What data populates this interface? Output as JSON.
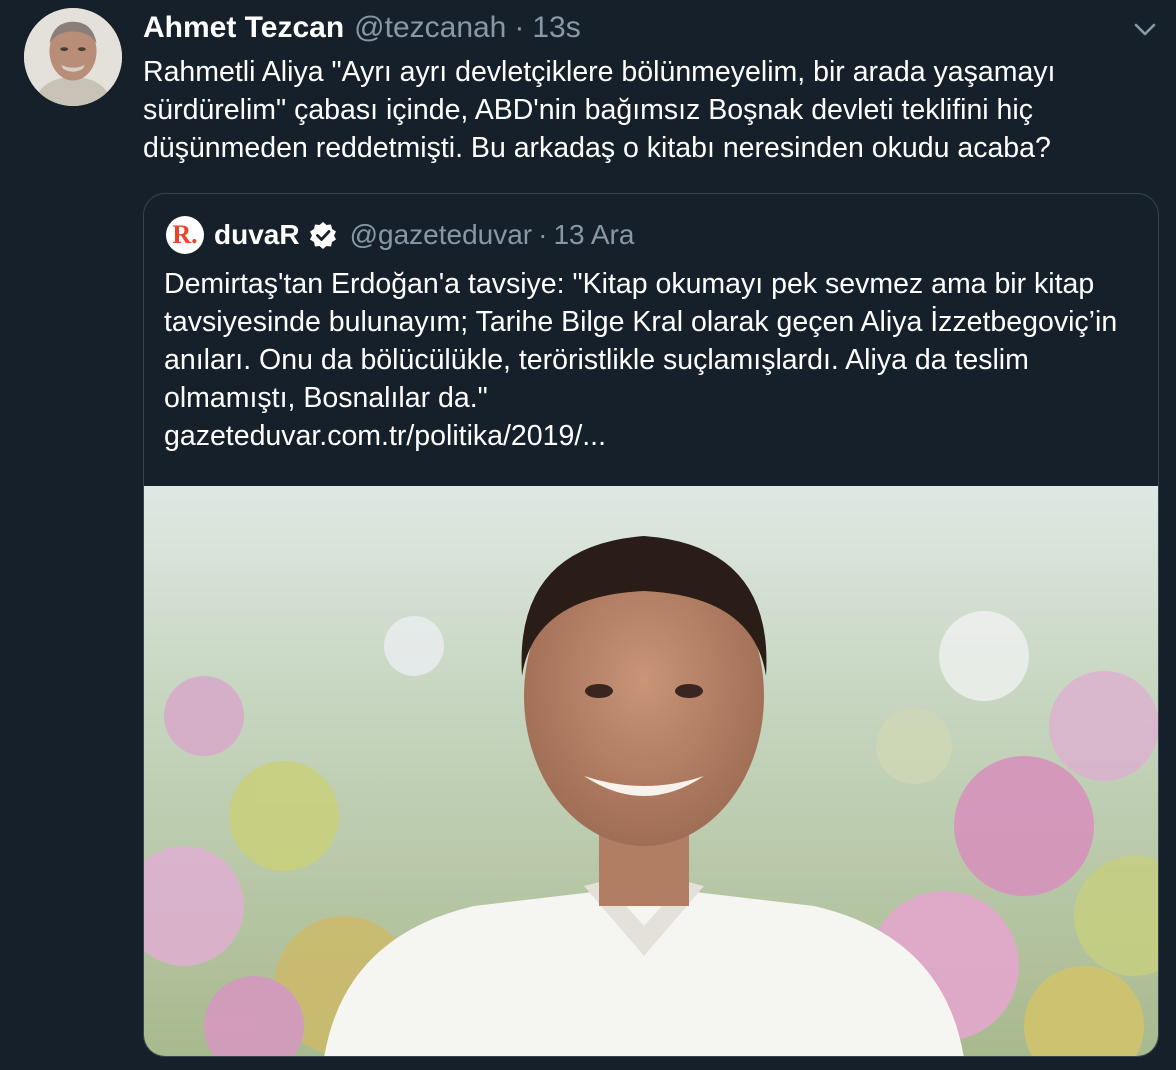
{
  "tweet": {
    "author_name": "Ahmet Tezcan",
    "author_handle": "@tezcanah",
    "separator": "·",
    "time": "13s",
    "text": "Rahmetli Aliya \"Ayrı ayrı devletçiklere bölünmeyelim, bir arada yaşamayı sürdürelim\" çabası içinde, ABD'nin bağımsız Boşnak devleti teklifini hiç düşünmeden reddetmişti. Bu arkadaş o kitabı neresinden okudu acaba?",
    "avatar_icon": "user-avatar-photo",
    "menu_icon": "chevron-down-icon"
  },
  "quoted": {
    "logo_text": "R.",
    "author_name": "duvaR",
    "verified_icon": "verified-badge-icon",
    "author_handle": "@gazeteduvar",
    "separator": "·",
    "time": "13 Ara",
    "text": "Demirtaş'tan Erdoğan'a tavsiye: \"Kitap okumayı pek sevmez ama bir kitap tavsiyesinde bulunayım; Tarihe Bilge Kral olarak geçen Aliya İzzetbegoviç’in anıları. Onu da bölücülükle, teröristlikle suçlamışlardı. Aliya da teslim olmamıştı, Bosnalılar da.\"",
    "link": "gazeteduvar.com.tr/politika/2019/...",
    "image_alt": "man-in-white-shirt-flower-field-photo"
  },
  "colors": {
    "background": "#15202b",
    "secondary_text": "#8899a6",
    "border": "#38444d",
    "brand_logo": "#e8452c"
  }
}
